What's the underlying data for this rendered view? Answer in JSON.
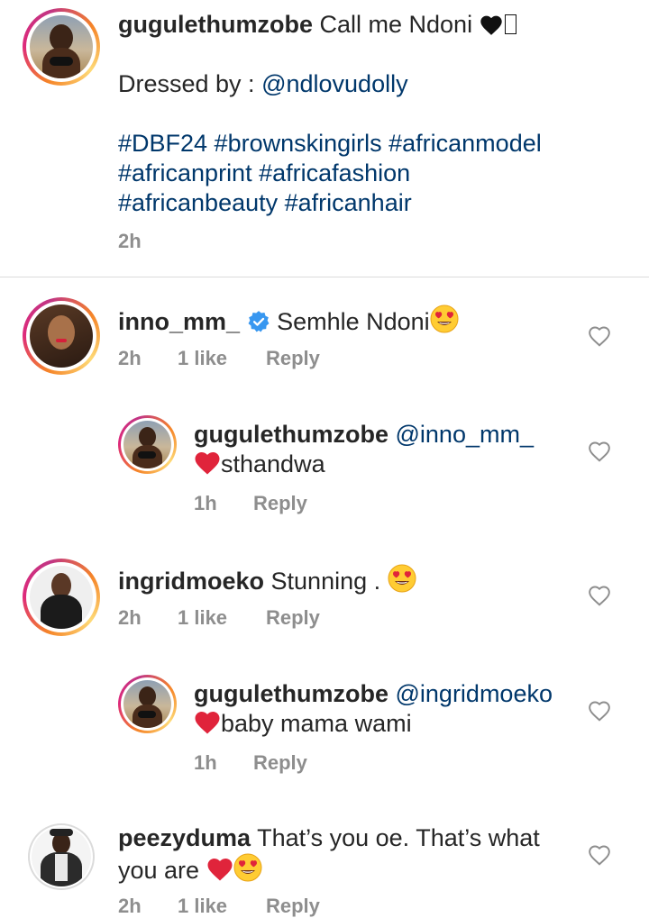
{
  "caption": {
    "username": "gugulethumzobe",
    "text": "Call me Ndoni",
    "trail_glyph": "🖤🇿",
    "dressed_prefix": "Dressed by :",
    "dressed_mention": "@ndlovudolly",
    "hashtags_line1": "#DBF24 #brownskingirls #africanmodel",
    "hashtags_line2": "#africanprint #africafashion",
    "hashtags_line3": "#africanbeauty #africanhair",
    "time": "2h"
  },
  "comments": [
    {
      "username": "inno_mm_",
      "verified": true,
      "text": "Semhle Ndoni",
      "time": "2h",
      "likes": "1 like",
      "reply": "Reply",
      "reply_comment": {
        "username": "gugulethumzobe",
        "mention": "@inno_mm_",
        "text": "sthandwa",
        "time": "1h",
        "reply": "Reply"
      }
    },
    {
      "username": "ingridmoeko",
      "verified": false,
      "text": "Stunning .",
      "time": "2h",
      "likes": "1 like",
      "reply": "Reply",
      "reply_comment": {
        "username": "gugulethumzobe",
        "mention": "@ingridmoeko",
        "text": "baby mama wami",
        "time": "1h",
        "reply": "Reply"
      }
    },
    {
      "username": "peezyduma",
      "verified": false,
      "text_line1": "That’s you oe. That’s what",
      "text_line2": "you are",
      "time": "2h",
      "likes": "1 like",
      "reply": "Reply"
    }
  ],
  "colors": {
    "text": "#262626",
    "link": "#00376b",
    "meta": "#8e8e8e",
    "heart_red": "#e0243b",
    "verified_blue": "#3897f0"
  }
}
